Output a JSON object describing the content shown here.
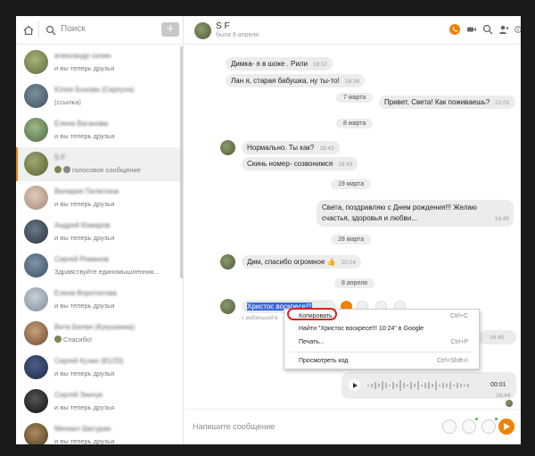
{
  "sidebar": {
    "search_placeholder": "Поиск",
    "add_label": "+",
    "chats": [
      {
        "name": "александр силин",
        "sub": "и вы теперь друзья"
      },
      {
        "name": "Юлия Бонова (Серпуха)",
        "sub": "(ссылка)"
      },
      {
        "name": "Елена Ваганова",
        "sub": "и вы теперь друзья"
      },
      {
        "name": "S F",
        "sub": "голосовое сообщение",
        "active": true
      },
      {
        "name": "Валерия Пилютина",
        "sub": "и вы теперь друзья"
      },
      {
        "name": "Андрей Комаров",
        "sub": "и вы теперь друзья"
      },
      {
        "name": "Сергей Романов",
        "sub": "Здравствуйте единомышленник..."
      },
      {
        "name": "Елена Воротилова",
        "sub": "и вы теперь друзья"
      },
      {
        "name": "Вита Белая (Кукушкина)",
        "sub": "Спасибо!"
      },
      {
        "name": "Сергей Кузин (81/20)",
        "sub": "и вы теперь друзья"
      },
      {
        "name": "Сергей Зинчук",
        "sub": "и вы теперь друзья"
      },
      {
        "name": "Михаил Шатурин",
        "sub": "и вы теперь друзья"
      }
    ]
  },
  "chat": {
    "name": "S F",
    "status": "была 8 апреля",
    "composer_placeholder": "Напишите сообщение",
    "messages": {
      "m1": {
        "text": "Димка- я в шоке . Рили",
        "time": "18:37"
      },
      "m2": {
        "text": "Лан я, старая бабушка, ну ты-то!",
        "time": "18:38"
      },
      "d1": "7 марта",
      "m3": {
        "text": "Привет, Света! Как поживаешь?",
        "time": "22:01"
      },
      "d2": "8 марта",
      "m4": {
        "text": "Нормально. Ты как?",
        "time": "18:43"
      },
      "m5": {
        "text": "Скинь номер- созвонимся",
        "time": "18:43"
      },
      "d3": "19 марта",
      "m6": {
        "line1": "Света, поздравляю с Днем рождения!!! Желаю",
        "line2": "счастья, здоровья и любви...",
        "time": "16:45"
      },
      "d4": "28 марта",
      "m7": {
        "text": "Дим, спасибо огромное",
        "emoji": "👍",
        "time": "20:24"
      },
      "d5": "8 апреля",
      "m8": {
        "text": "Христос воскресе!!!",
        "mobile": "с мобильной в"
      },
      "m9": {
        "time": "16:45"
      },
      "voice": {
        "time": "00:01",
        "sent": "16:44"
      }
    }
  },
  "context_menu": {
    "copy": {
      "label": "Копировать",
      "shortcut": "Ctrl+C"
    },
    "google": {
      "label": "Найти \"Христос воскресе!!! 10:24\" в Google"
    },
    "print": {
      "label": "Печать...",
      "shortcut": "Ctrl+P"
    },
    "source": {
      "label": "Просмотреть код",
      "shortcut": "Ctrl+Shift+I"
    }
  },
  "colors": {
    "accent": "#ee8208",
    "selection": "#3a66d8",
    "highlight": "#dd2222"
  }
}
